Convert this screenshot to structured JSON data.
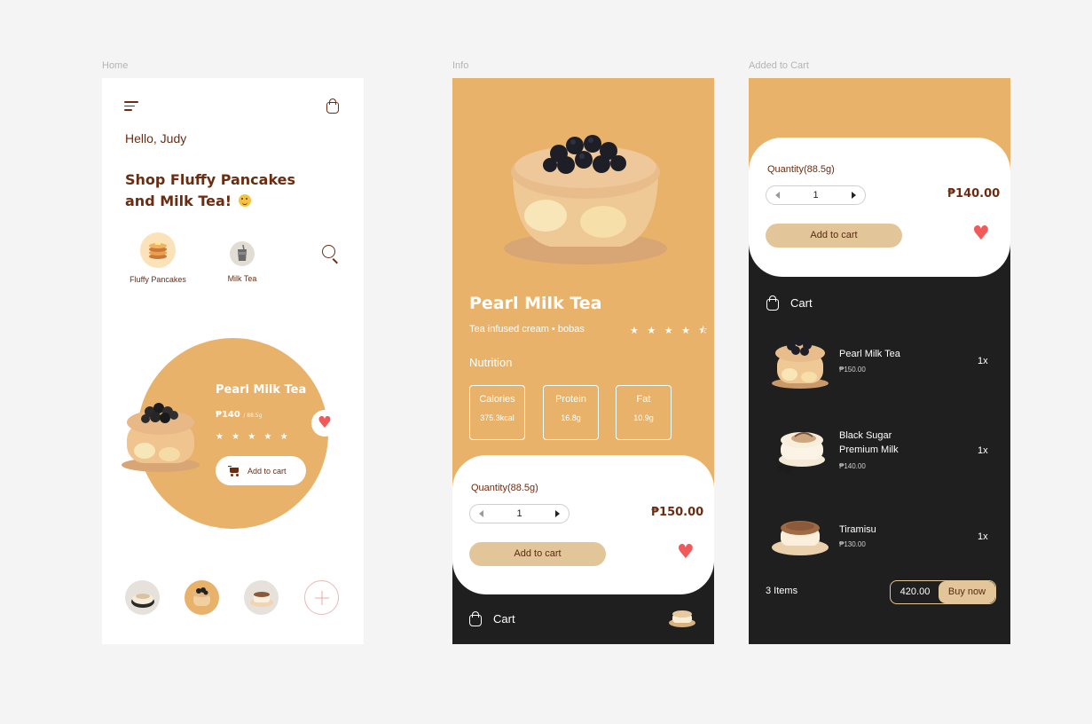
{
  "frames": {
    "home_label": "Home",
    "info_label": "Info",
    "cart_label": "Added to Cart"
  },
  "home": {
    "greeting": "Hello, Judy",
    "headline_line1": "Shop Fluffy Pancakes",
    "headline_line2": "and Milk Tea!",
    "categories": [
      "Fluffy Pancakes",
      "Milk Tea"
    ],
    "featured": {
      "title": "Pearl Milk Tea",
      "price": "₱140",
      "weight": "/ 88.5g",
      "stars": "★ ★ ★ ★ ★",
      "add_label": "Add to cart"
    }
  },
  "info": {
    "title": "Pearl Milk Tea",
    "subtitle": "Tea infused cream • bobas",
    "rating_stars": "★ ★ ★ ★ ⯪",
    "nutrition_label": "Nutrition",
    "nutrition": [
      {
        "name": "Calories",
        "value": "375.3kcal"
      },
      {
        "name": "Protein",
        "value": "16.8g"
      },
      {
        "name": "Fat",
        "value": "10.9g"
      }
    ],
    "quantity_label": "Quantity(88.5g)",
    "quantity": "1",
    "price": "₱150.00",
    "add_label": "Add to cart",
    "cart_label": "Cart"
  },
  "cart": {
    "quantity_label": "Quantity(88.5g)",
    "quantity": "1",
    "price": "₱140.00",
    "add_label": "Add to cart",
    "cart_label": "Cart",
    "items": [
      {
        "name_line1": "Pearl Milk Tea",
        "name_line2": "",
        "price": "₱150.00",
        "qty": "1x"
      },
      {
        "name_line1": "Black Sugar",
        "name_line2": "Premium Milk",
        "price": "₱140.00",
        "qty": "1x"
      },
      {
        "name_line1": "Tiramisu",
        "name_line2": "",
        "price": "₱130.00",
        "qty": "1x"
      }
    ],
    "items_count": "3 Items",
    "total": "420.00",
    "buy_label": "Buy now"
  },
  "colors": {
    "accent": "#e8b26a",
    "brown": "#6b2d12",
    "dark": "#1f1f1f",
    "heart": "#f25a5a",
    "button": "#e3c59a"
  }
}
